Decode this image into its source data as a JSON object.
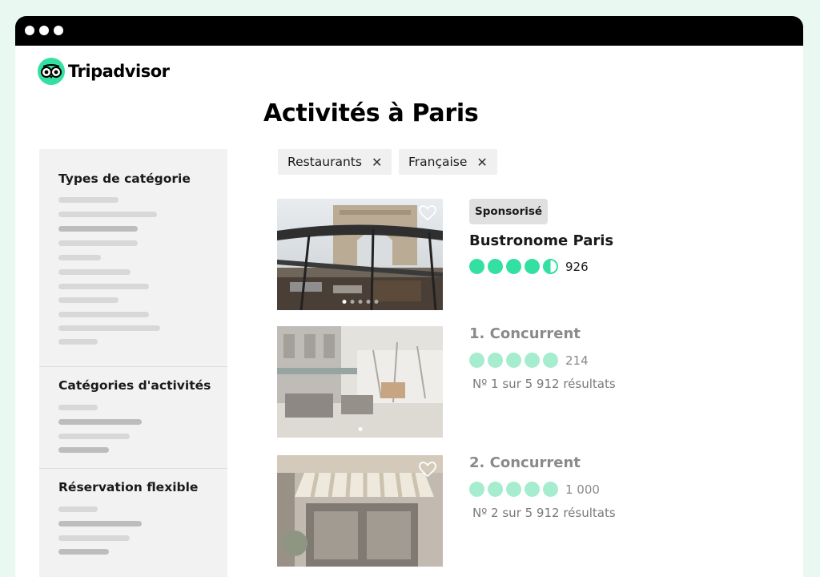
{
  "brand": {
    "name": "Tripadvisor",
    "accent": "#34e0a1"
  },
  "page": {
    "title": "Activités à Paris"
  },
  "filters": [
    {
      "label": "Restaurants",
      "remove_icon": "close-icon"
    },
    {
      "label": "Française",
      "remove_icon": "close-icon"
    }
  ],
  "sidebar": {
    "sections": [
      {
        "title": "Types de catégorie"
      },
      {
        "title": "Catégories d'activités"
      },
      {
        "title": "Réservation flexible"
      }
    ]
  },
  "results": [
    {
      "badge": "Sponsorisé",
      "title": "Bustronome Paris",
      "rating": 4.5,
      "reviews": "926",
      "rank": ""
    },
    {
      "badge": "",
      "title": "1. Concurrent",
      "rating": 5,
      "reviews": "214",
      "rank": "Nº 1 sur 5 912 résultats"
    },
    {
      "badge": "",
      "title": "2. Concurrent",
      "rating": 5,
      "reviews": "1 000",
      "rank": "Nº 2 sur 5 912 résultats"
    }
  ],
  "colors": {
    "bubble_full": "#34e0a1",
    "bubble_faded": "#a6eccf"
  }
}
